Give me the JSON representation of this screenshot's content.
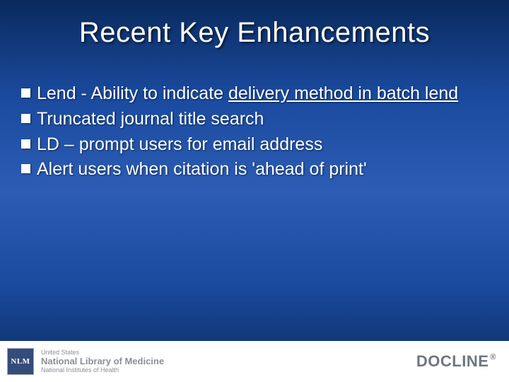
{
  "title": "Recent Key Enhancements",
  "bullets": [
    {
      "prefix": "Lend - Ability to indicate ",
      "underlined": "delivery method in batch lend",
      "suffix": ""
    },
    {
      "prefix": "Truncated journal title search",
      "underlined": "",
      "suffix": ""
    },
    {
      "prefix": "LD – prompt users for email address",
      "underlined": "",
      "suffix": ""
    },
    {
      "prefix": "Alert users when citation is 'ahead of print'",
      "underlined": "",
      "suffix": ""
    }
  ],
  "footer": {
    "logo_text": "NLM",
    "line1": "United States",
    "line2": "National Library of Medicine",
    "line3": "National Institutes of Health",
    "brand": "DOCLINE",
    "reg": "®"
  }
}
